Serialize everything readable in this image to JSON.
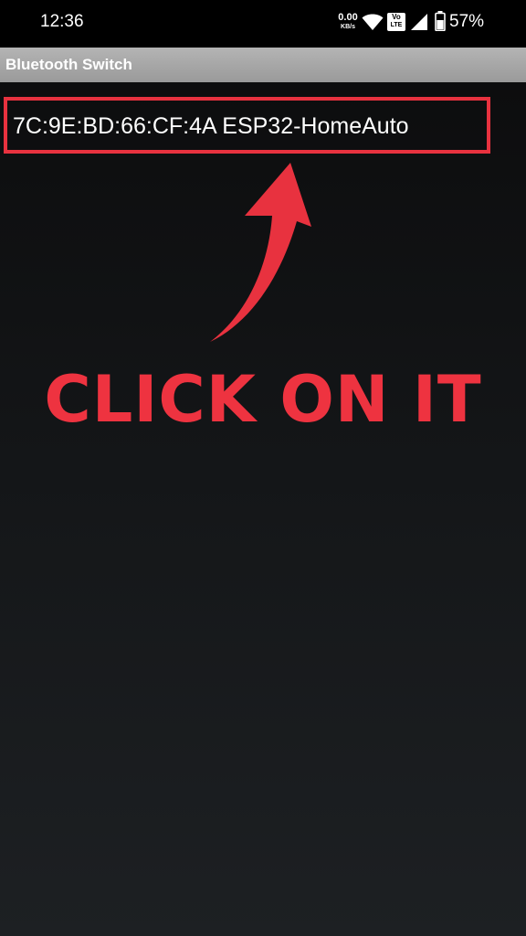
{
  "status_bar": {
    "time": "12:36",
    "net_speed_value": "0.00",
    "net_speed_unit": "KB/s",
    "volte_top": "Vo",
    "volte_bottom": "LTE",
    "battery_percent": "57%",
    "icons": [
      "wifi-icon",
      "volte-icon",
      "signal-icon",
      "battery-icon"
    ]
  },
  "app": {
    "title": "Bluetooth Switch"
  },
  "device_list": {
    "items": [
      {
        "label": "7C:9E:BD:66:CF:4A ESP32-HomeAuto"
      }
    ]
  },
  "annotation": {
    "callout": "CLICK ON IT",
    "icon": "curved-arrow-up-icon"
  },
  "colors": {
    "highlight": "#e8323f",
    "callout": "#ee3340",
    "title_bar": "#a8a8a8",
    "background_top": "#0b0b0c",
    "background_bottom": "#1d2023"
  }
}
